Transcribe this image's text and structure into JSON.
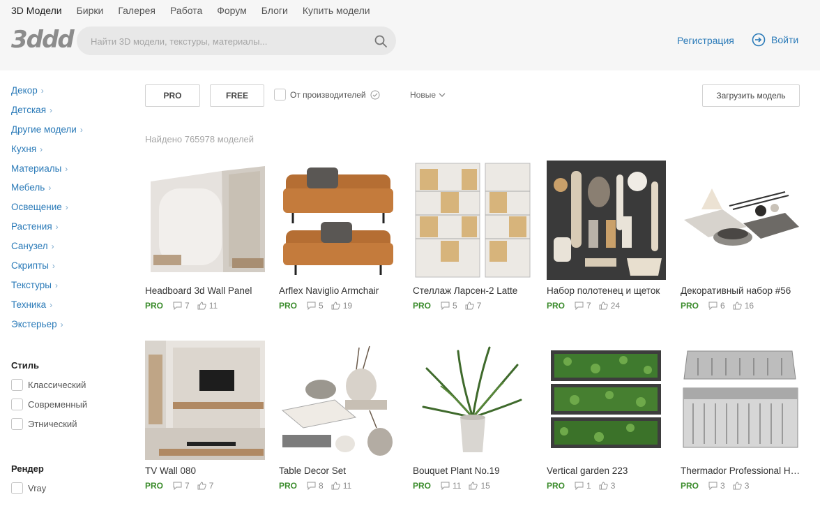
{
  "topnav": [
    "3D Модели",
    "Бирки",
    "Галерея",
    "Работа",
    "Форум",
    "Блоги",
    "Купить модели"
  ],
  "logo": "3ddd",
  "search": {
    "placeholder": "Найти 3D модели, текстуры, материалы..."
  },
  "auth": {
    "register": "Регистрация",
    "login": "Войти"
  },
  "categories": [
    "Декор",
    "Детская",
    "Другие модели",
    "Кухня",
    "Материалы",
    "Мебель",
    "Освещение",
    "Растения",
    "Санузел",
    "Скрипты",
    "Текстуры",
    "Техника",
    "Экстерьер"
  ],
  "style_section": {
    "title": "Стиль",
    "options": [
      "Классический",
      "Современный",
      "Этнический"
    ]
  },
  "render_section": {
    "title": "Рендер",
    "options": [
      "Vray"
    ]
  },
  "filters": {
    "pro": "PRO",
    "free": "FREE",
    "manufacturer": "От производителей",
    "sort": "Новые",
    "upload": "Загрузить модель"
  },
  "found_text": "Найдено 765978 моделей",
  "pro_label": "PRO",
  "models": [
    {
      "title": "Headboard 3d Wall Panel",
      "comments": "7",
      "likes": "11"
    },
    {
      "title": "Arflex Naviglio Armchair",
      "comments": "5",
      "likes": "19"
    },
    {
      "title": "Стеллаж Ларсен-2 Latte",
      "comments": "5",
      "likes": "7"
    },
    {
      "title": "Набор полотенец и щеток",
      "comments": "7",
      "likes": "24"
    },
    {
      "title": "Декоративный набор #56",
      "comments": "6",
      "likes": "16"
    },
    {
      "title": "TV Wall 080",
      "comments": "7",
      "likes": "7"
    },
    {
      "title": "Table Decor Set",
      "comments": "8",
      "likes": "11"
    },
    {
      "title": "Bouquet Plant No.19",
      "comments": "11",
      "likes": "15"
    },
    {
      "title": "Vertical garden 223",
      "comments": "1",
      "likes": "3"
    },
    {
      "title": "Thermador Professional Hood",
      "comments": "3",
      "likes": "3"
    }
  ],
  "colors": {
    "link": "#2a7ab8",
    "pro": "#3a8b2b",
    "header_bg": "#f6f6f6"
  }
}
